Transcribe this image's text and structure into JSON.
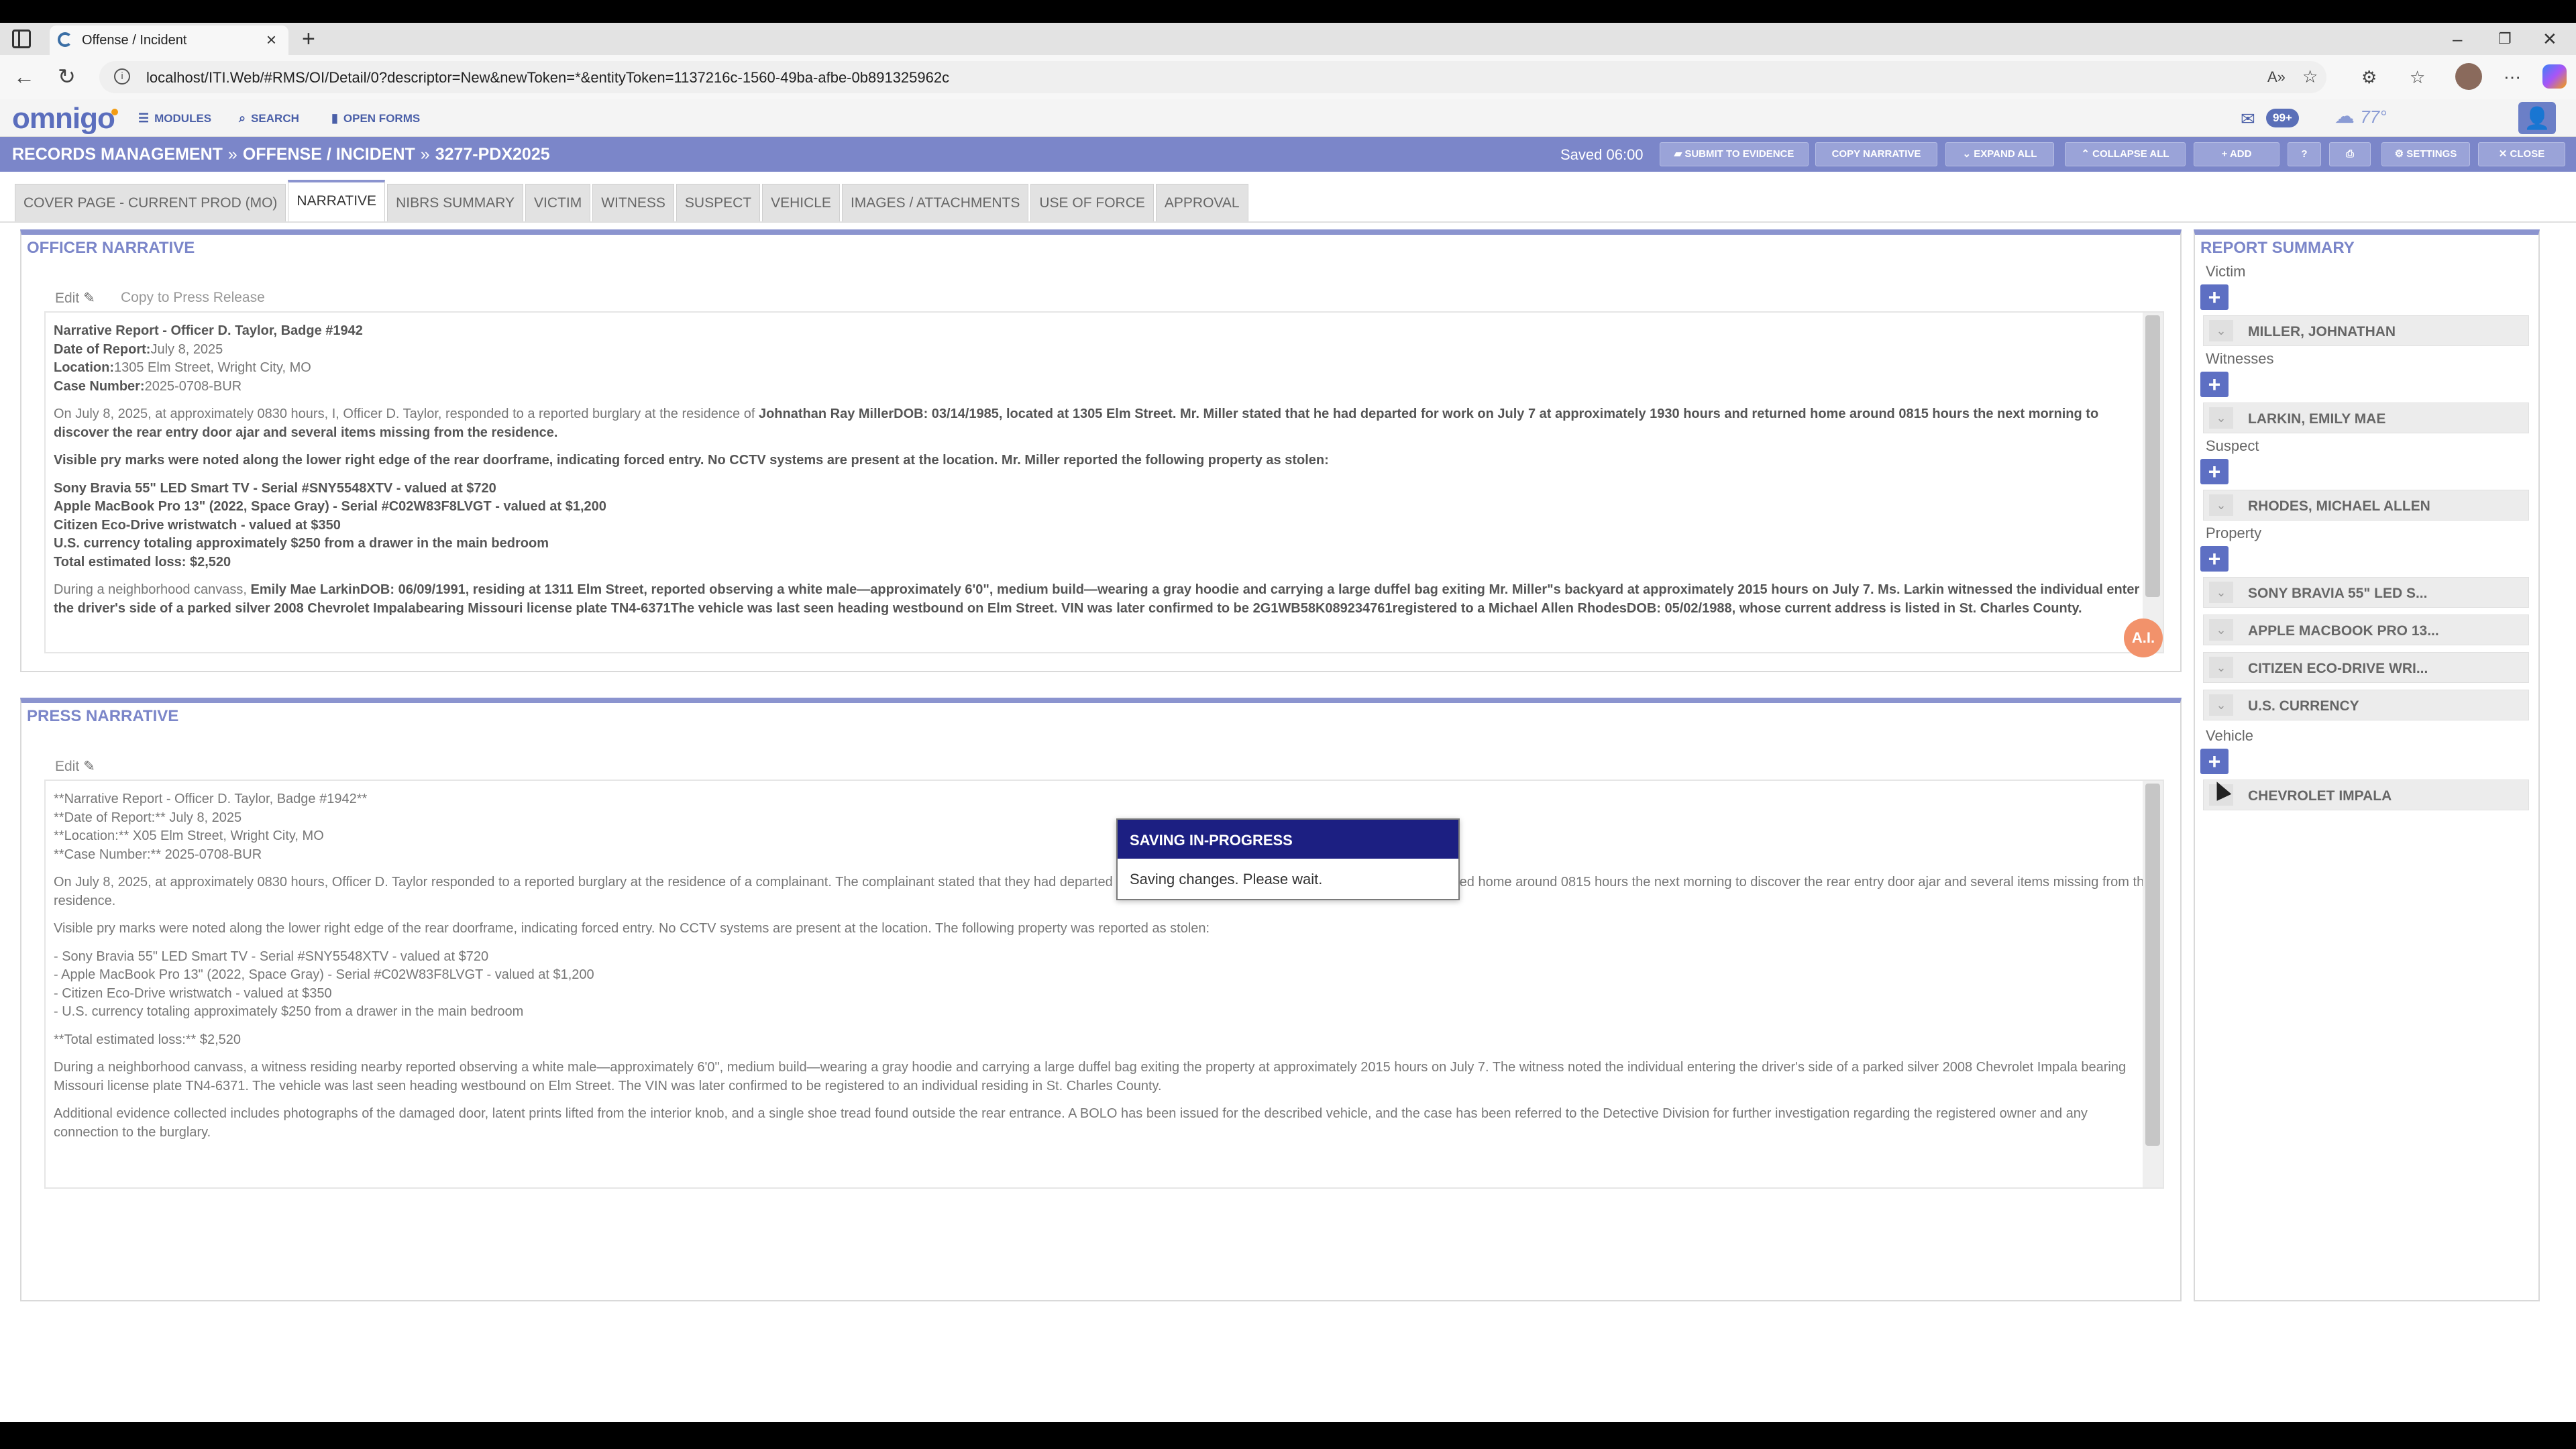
{
  "browser": {
    "tab_title": "Offense / Incident",
    "url": "localhost/ITI.Web/#RMS/OI/Detail/0?descriptor=New&newToken=*&entityToken=1137216c-1560-49ba-afbe-0b891325962c"
  },
  "app": {
    "logo": "omnigo",
    "nav": {
      "modules": "MODULES",
      "search": "SEARCH",
      "open_forms": "OPEN FORMS"
    },
    "mail_badge": "99+",
    "weather": "77°"
  },
  "header": {
    "crumb1": "RECORDS MANAGEMENT",
    "crumb2": "OFFENSE / INCIDENT",
    "crumb3": "3277-PDX2025",
    "sep": "»",
    "saved": "Saved 06:00",
    "buttons": {
      "submit": "SUBMIT TO EVIDENCE",
      "copy": "COPY NARRATIVE",
      "expand": "EXPAND ALL",
      "collapse": "COLLAPSE ALL",
      "add": "ADD",
      "help": "?",
      "settings": "SETTINGS",
      "close": "CLOSE"
    }
  },
  "tabs": [
    "COVER PAGE - CURRENT PROD (MO)",
    "NARRATIVE",
    "NIBRS SUMMARY",
    "VICTIM",
    "WITNESS",
    "SUSPECT",
    "VEHICLE",
    "IMAGES / ATTACHMENTS",
    "USE OF FORCE",
    "APPROVAL"
  ],
  "officer": {
    "title": "OFFICER NARRATIVE",
    "edit": "Edit",
    "copy_press": "Copy to Press Release",
    "h_title": "Narrative Report - Officer D. Taylor, Badge #1942",
    "h_date_label": "Date of Report:",
    "h_date": "July 8, 2025",
    "h_loc_label": "Location:",
    "h_loc": "1305 Elm Street, Wright City, MO",
    "h_case_label": "Case Number:",
    "h_case": "2025-0708-BUR",
    "p1a": "On July 8, 2025, at approximately 0830 hours, I, Officer D. Taylor, responded to a reported burglary at the residence of ",
    "p1b": "Johnathan Ray MillerDOB: 03/14/1985, located at 1305 Elm Street. Mr. Miller stated that he had departed for work on July 7 at approximately 1930 hours and returned home around 0815 hours the next morning to discover the rear entry door ajar and several items missing from the residence.",
    "p2": "Visible pry marks were noted along the lower right edge of the rear doorframe, indicating forced entry. No CCTV systems are present at the location. Mr. Miller reported the following property as stolen:",
    "l1": "Sony Bravia 55\" LED Smart TV - Serial #SNY5548XTV - valued at $720",
    "l2": "Apple MacBook Pro 13\" (2022, Space Gray) - Serial #C02W83F8LVGT - valued at $1,200",
    "l3": "Citizen Eco-Drive wristwatch - valued at $350",
    "l4": "U.S. currency totaling approximately $250 from a drawer in the main bedroom",
    "l5": "Total estimated loss: $2,520",
    "p3a": "During a neighborhood canvass, ",
    "p3b": "Emily Mae LarkinDOB: 06/09/1991, residing at 1311 Elm Street, reported observing a white male—approximately 6'0\", medium build—wearing a gray hoodie and carrying a large duffel bag exiting Mr. Miller\"s backyard at approximately 2015 hours on July 7. Ms. Larkin witnessed the individual enter the driver's side of a parked silver 2008 Chevrolet Impalabearing Missouri license plate TN4-6371The vehicle was last seen heading westbound on Elm Street. VIN was later confirmed to be 2G1WB58K089234761registered to a Michael Allen RhodesDOB: 05/02/1988, whose current address is listed in St. Charles County.",
    "ai": "A.I."
  },
  "press": {
    "title": "PRESS NARRATIVE",
    "edit": "Edit",
    "h1": "**Narrative Report - Officer D. Taylor, Badge #1942**",
    "h2": "**Date of Report:** July 8, 2025",
    "h3": "**Location:** X05 Elm Street, Wright City, MO",
    "h4": "**Case Number:** 2025-0708-BUR",
    "p1": "On July 8, 2025, at approximately 0830 hours, Officer D. Taylor responded to a reported burglary at the residence of a complainant. The complainant stated that they had departed for work on July 7 at approximately 1930 hours and returned home around 0815 hours the next morning to discover the rear entry door ajar and several items missing from the residence.",
    "p2": "Visible pry marks were noted along the lower right edge of the rear doorframe, indicating forced entry. No CCTV systems are present at the location. The following property was reported as stolen:",
    "l1": "- Sony Bravia 55\" LED Smart TV - Serial #SNY5548XTV - valued at $720",
    "l2": "- Apple MacBook Pro 13\" (2022, Space Gray) - Serial #C02W83F8LVGT - valued at $1,200",
    "l3": "- Citizen Eco-Drive wristwatch - valued at $350",
    "l4": "- U.S. currency totaling approximately $250 from a drawer in the main bedroom",
    "total": "**Total estimated loss:** $2,520",
    "p3": "During a neighborhood canvass, a witness residing nearby reported observing a white male—approximately 6'0\", medium build—wearing a gray hoodie and carrying a large duffel bag exiting the property at approximately 2015 hours on July 7. The witness noted the individual entering the driver's side of a parked silver 2008 Chevrolet Impala bearing Missouri license plate TN4-6371. The vehicle was last seen heading westbound on Elm Street. The VIN was later confirmed to be registered to an individual residing in St. Charles County.",
    "p4": "Additional evidence collected includes photographs of the damaged door, latent prints lifted from the interior knob, and a single shoe tread found outside the rear entrance. A BOLO has been issued for the described vehicle, and the case has been referred to the Detective Division for further investigation regarding the registered owner and any connection to the burglary."
  },
  "summary": {
    "title": "REPORT SUMMARY",
    "victim": "Victim",
    "victim_item": "MILLER, JOHNATHAN",
    "witnesses": "Witnesses",
    "witness_item": "LARKIN, EMILY MAE",
    "suspect": "Suspect",
    "suspect_item": "RHODES, MICHAEL ALLEN",
    "property": "Property",
    "prop1": "SONY BRAVIA 55\" LED S...",
    "prop2": "APPLE MACBOOK PRO 13...",
    "prop3": "CITIZEN ECO-DRIVE WRI...",
    "prop4": "U.S. CURRENCY",
    "vehicle": "Vehicle",
    "vehicle_item": "CHEVROLET IMPALA",
    "plus": "+"
  },
  "modal": {
    "title": "SAVING IN-PROGRESS",
    "body": "Saving changes. Please wait."
  }
}
